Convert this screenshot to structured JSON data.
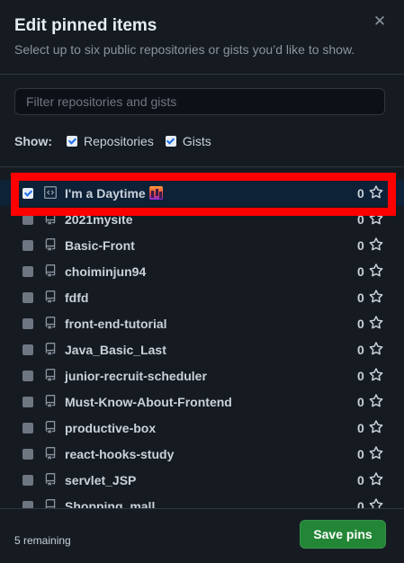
{
  "dialog": {
    "title": "Edit pinned items",
    "subtitle": "Select up to six public repositories or gists you’d like to show.",
    "close_icon": "close-icon"
  },
  "filter": {
    "placeholder": "Filter repositories and gists",
    "value": ""
  },
  "show": {
    "label": "Show:",
    "options": [
      {
        "label": "Repositories",
        "checked": true
      },
      {
        "label": "Gists",
        "checked": true
      }
    ]
  },
  "items": [
    {
      "name": "I'm a Daytime",
      "type": "gist",
      "icon": "code-icon",
      "has_emoji": true,
      "count": "0",
      "checked": true
    },
    {
      "name": "2021mysite",
      "type": "repo",
      "icon": "repo-icon",
      "count": "0",
      "checked": false
    },
    {
      "name": "Basic-Front",
      "type": "repo",
      "icon": "repo-icon",
      "count": "0",
      "checked": false
    },
    {
      "name": "choiminjun94",
      "type": "repo",
      "icon": "repo-icon",
      "count": "0",
      "checked": false
    },
    {
      "name": "fdfd",
      "type": "repo",
      "icon": "repo-icon",
      "count": "0",
      "checked": false
    },
    {
      "name": "front-end-tutorial",
      "type": "repo",
      "icon": "repo-icon",
      "count": "0",
      "checked": false
    },
    {
      "name": "Java_Basic_Last",
      "type": "repo",
      "icon": "repo-icon",
      "count": "0",
      "checked": false
    },
    {
      "name": "junior-recruit-scheduler",
      "type": "repo",
      "icon": "repo-icon",
      "count": "0",
      "checked": false
    },
    {
      "name": "Must-Know-About-Frontend",
      "type": "repo",
      "icon": "repo-icon",
      "count": "0",
      "checked": false
    },
    {
      "name": "productive-box",
      "type": "repo",
      "icon": "repo-icon",
      "count": "0",
      "checked": false
    },
    {
      "name": "react-hooks-study",
      "type": "repo",
      "icon": "repo-icon",
      "count": "0",
      "checked": false
    },
    {
      "name": "servlet_JSP",
      "type": "repo",
      "icon": "repo-icon",
      "count": "0",
      "checked": false
    },
    {
      "name": "Shopping_mall",
      "type": "repo",
      "icon": "repo-icon",
      "count": "0",
      "checked": false
    }
  ],
  "footer": {
    "remaining": "5 remaining",
    "save_label": "Save pins"
  },
  "colors": {
    "background": "#161b22",
    "accent_green": "#238636",
    "highlight_red": "#ff0000"
  }
}
